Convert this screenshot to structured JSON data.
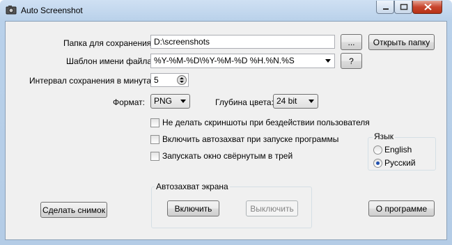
{
  "window": {
    "title": "Auto Screenshot"
  },
  "save_folder": {
    "label": "Папка для сохранения:",
    "value": "D:\\screenshots",
    "browse_label": "...",
    "open_label": "Открыть папку"
  },
  "filename_template": {
    "label": "Шаблон имени файла:",
    "value": "%Y-%M-%D\\%Y-%M-%D %H.%N.%S",
    "help_label": "?"
  },
  "interval": {
    "label": "Интервал сохранения в минутах:",
    "value": "5"
  },
  "format": {
    "label": "Формат:",
    "value": "PNG"
  },
  "color_depth": {
    "label": "Глубина цвета:",
    "value": "24 bit"
  },
  "options": [
    {
      "label": "Не делать скриншоты при бездействии пользователя",
      "checked": false
    },
    {
      "label": "Включить автозахват при запуске программы",
      "checked": false
    },
    {
      "label": "Запускать окно свёрнутым в трей",
      "checked": false
    }
  ],
  "language": {
    "title": "Язык",
    "options": [
      {
        "label": "English",
        "selected": false
      },
      {
        "label": "Русский",
        "selected": true
      }
    ]
  },
  "autocapture": {
    "title": "Автозахват экрана",
    "enable_label": "Включить",
    "disable_label": "Выключить"
  },
  "snapshot_button": "Сделать снимок",
  "about_button": "О программе"
}
